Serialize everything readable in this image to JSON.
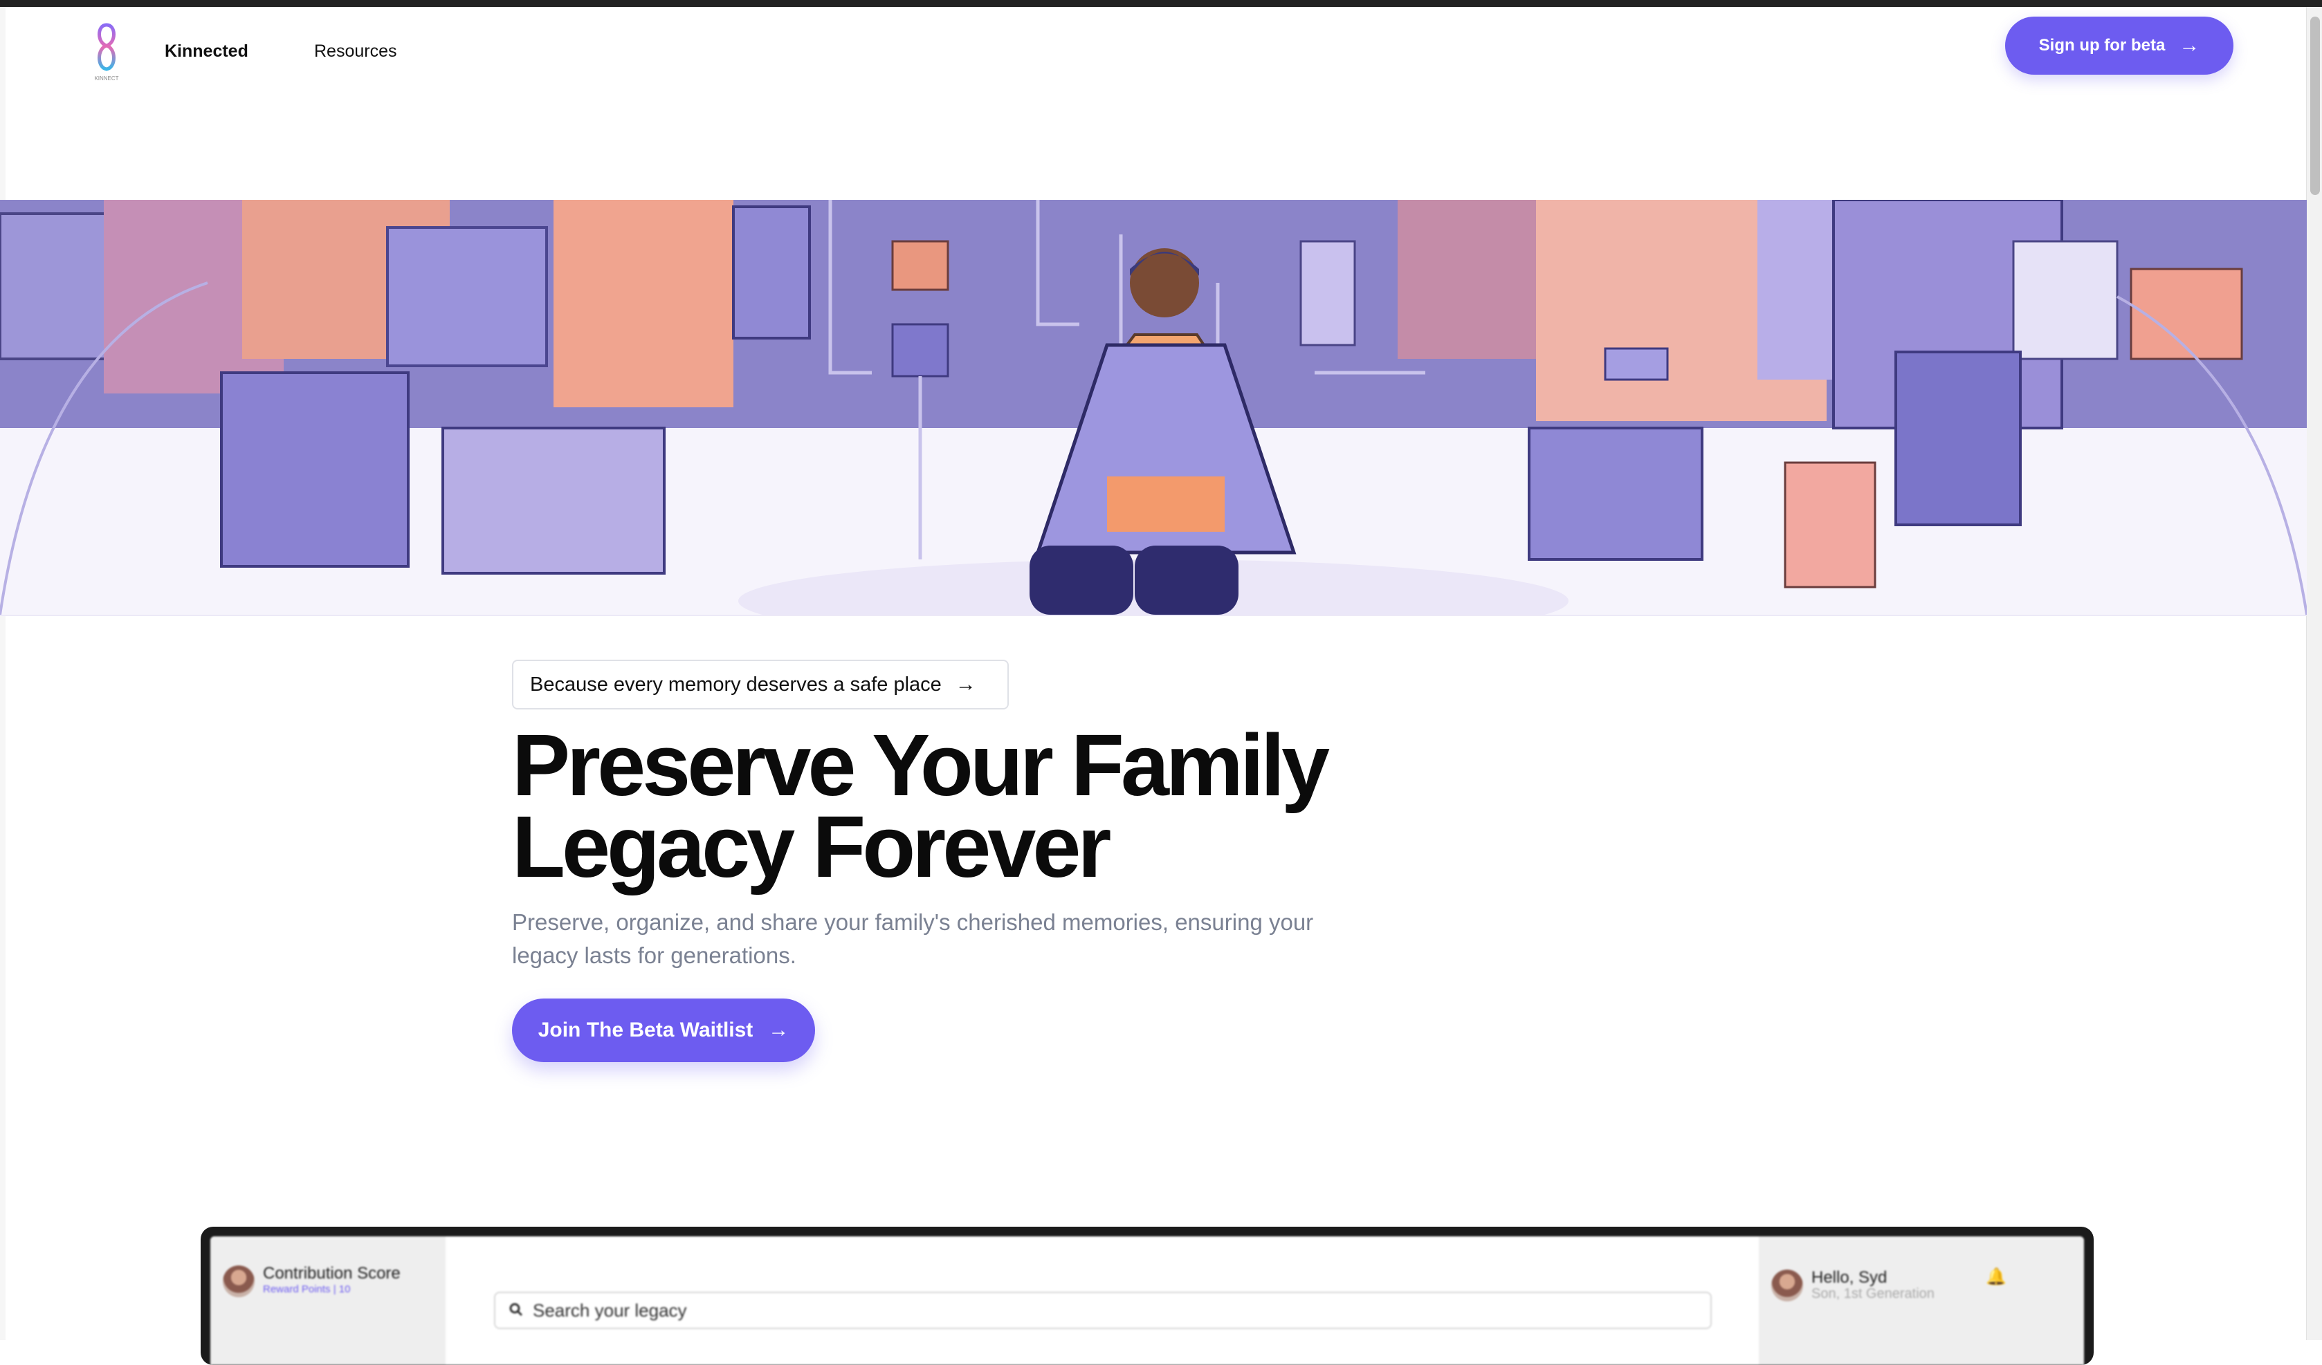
{
  "nav": {
    "brand": "Kinnected",
    "resources": "Resources",
    "cta": "Sign up for beta",
    "logo_caption": "KINNECT"
  },
  "hero": {
    "tagline": "Because every memory deserves a safe place",
    "headline_line1": "Preserve Your Family",
    "headline_line2": "Legacy Forever",
    "subtext": "Preserve, organize, and share your family's cherished memories, ensuring your legacy lasts for generations.",
    "join_button": "Join The Beta Waitlist"
  },
  "app_preview": {
    "contribution_title": "Contribution Score",
    "contribution_sub": "Reward Points | 10",
    "search_placeholder": "Search your legacy",
    "greeting": "Hello, Syd",
    "greeting_sub": "Son, 1st Generation"
  },
  "colors": {
    "accent": "#6d5cf0",
    "text": "#0b0b0b",
    "muted": "#7a8192"
  },
  "icons": [
    "kinnect-logo-icon",
    "arrow-right-icon",
    "search-icon",
    "bell-icon",
    "avatar-icon"
  ]
}
